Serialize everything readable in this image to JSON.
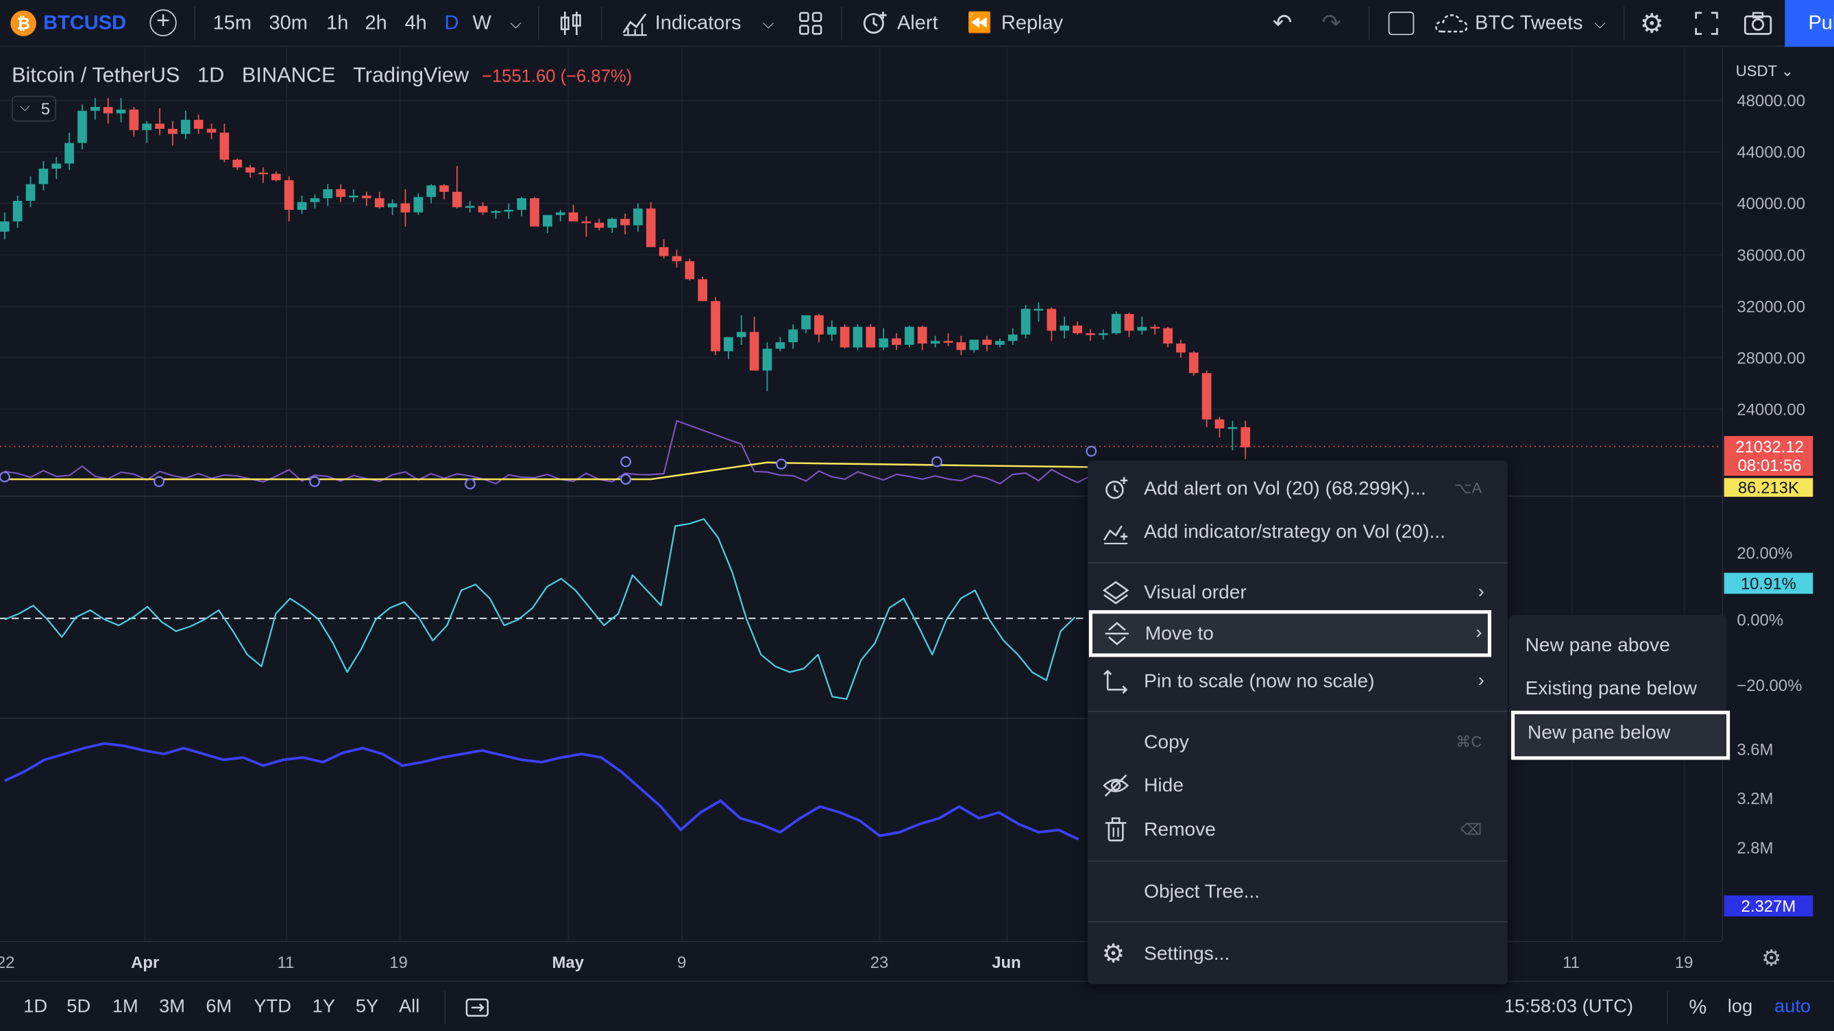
{
  "topbar": {
    "symbol": "BTCUSD",
    "intervals": [
      "15m",
      "30m",
      "1h",
      "2h",
      "4h",
      "D",
      "W"
    ],
    "active_interval": "D",
    "indicators_label": "Indicators",
    "alert_label": "Alert",
    "replay_label": "Replay",
    "layout_name": "BTC Tweets",
    "publish_label": "Pul"
  },
  "legend": {
    "pair": "Bitcoin / TetherUS",
    "interval": "1D",
    "exchange": "BINANCE",
    "source": "TradingView",
    "change": "−1551.60 (−6.87%)",
    "collapsed_count": "5"
  },
  "price_scale": {
    "currency": "USDT",
    "labels": [
      "48000.00",
      "44000.00",
      "40000.00",
      "36000.00",
      "32000.00",
      "28000.00",
      "24000.00"
    ],
    "last_price": "21032.12",
    "countdown": "08:01:56",
    "vol_tag": "86.213K",
    "osc_labels": [
      "20.00%",
      "0.00%",
      "−20.00%"
    ],
    "osc_tag": "10.91%",
    "obv_labels": [
      "3.6M",
      "3.2M",
      "2.8M"
    ],
    "obv_tag": "2.327M"
  },
  "time_axis": [
    "22",
    "Apr",
    "11",
    "19",
    "May",
    "9",
    "23",
    "Jun",
    "11",
    "19"
  ],
  "bottombar": {
    "ranges": [
      "1D",
      "5D",
      "1M",
      "3M",
      "6M",
      "YTD",
      "1Y",
      "5Y",
      "All"
    ],
    "clock": "15:58:03 (UTC)",
    "percent": "%",
    "log": "log",
    "auto": "auto"
  },
  "context_menu": {
    "add_alert": "Add alert on Vol (20) (68.299K)...",
    "add_alert_shortcut": "⌥A",
    "add_indicator": "Add indicator/strategy on Vol (20)...",
    "visual_order": "Visual order",
    "move_to": "Move to",
    "pin_to_scale": "Pin to scale (now no scale)",
    "copy": "Copy",
    "copy_shortcut": "⌘C",
    "hide": "Hide",
    "remove": "Remove",
    "remove_shortcut": "⌫",
    "object_tree": "Object Tree...",
    "settings": "Settings..."
  },
  "submenu": {
    "new_pane_above": "New pane above",
    "existing_pane_below": "Existing pane below",
    "new_pane_below": "New pane below"
  },
  "colors": {
    "up": "#26a69a",
    "down": "#ef5350",
    "accent": "#2962ff",
    "volume_line": "#7e57c2",
    "volume_ma": "#f7e559",
    "oscillator": "#4dd0e1",
    "obv": "#3d41ff"
  },
  "chart_data": {
    "type": "candlestick",
    "title": "Bitcoin / TetherUS",
    "interval": "1D",
    "ylim": [
      20000,
      50000
    ],
    "candles": [
      [
        37800,
        39300,
        37200,
        38600
      ],
      [
        38600,
        40600,
        38100,
        40200
      ],
      [
        40200,
        42100,
        39700,
        41500
      ],
      [
        41500,
        43300,
        41000,
        42700
      ],
      [
        42700,
        43600,
        41900,
        43100
      ],
      [
        43100,
        45500,
        42600,
        44700
      ],
      [
        44700,
        47700,
        44200,
        47200
      ],
      [
        47200,
        48200,
        46500,
        47500
      ],
      [
        47500,
        48200,
        46200,
        47000
      ],
      [
        47000,
        48200,
        46300,
        47300
      ],
      [
        47300,
        47500,
        45200,
        45700
      ],
      [
        45700,
        46400,
        44700,
        46200
      ],
      [
        46200,
        47400,
        45300,
        45800
      ],
      [
        45800,
        46400,
        44500,
        45400
      ],
      [
        45400,
        47200,
        45000,
        46500
      ],
      [
        46500,
        46900,
        45400,
        45800
      ],
      [
        45800,
        46200,
        45000,
        45500
      ],
      [
        45500,
        46200,
        43200,
        43400
      ],
      [
        43400,
        43500,
        42600,
        42800
      ],
      [
        42800,
        43000,
        42000,
        42400
      ],
      [
        42400,
        42800,
        41600,
        42300
      ],
      [
        42300,
        42500,
        41700,
        41800
      ],
      [
        41800,
        42100,
        38600,
        39500
      ],
      [
        39500,
        40600,
        39200,
        40100
      ],
      [
        40100,
        40700,
        39600,
        40400
      ],
      [
        40400,
        41500,
        39800,
        41100
      ],
      [
        41100,
        41500,
        40100,
        40500
      ],
      [
        40500,
        41100,
        40100,
        40600
      ],
      [
        40600,
        40900,
        39800,
        40400
      ],
      [
        40400,
        40900,
        39600,
        39700
      ],
      [
        39700,
        40300,
        39100,
        40000
      ],
      [
        40000,
        41100,
        38200,
        39300
      ],
      [
        39300,
        40800,
        39100,
        40500
      ],
      [
        40500,
        41500,
        40000,
        41400
      ],
      [
        41400,
        41500,
        40300,
        40900
      ],
      [
        40900,
        42900,
        39600,
        39700
      ],
      [
        39700,
        40200,
        39300,
        39800
      ],
      [
        39800,
        40100,
        39100,
        39300
      ],
      [
        39300,
        39500,
        38800,
        39400
      ],
      [
        39400,
        40000,
        38800,
        39500
      ],
      [
        39500,
        40500,
        39000,
        40400
      ],
      [
        40400,
        40500,
        38200,
        38200
      ],
      [
        38200,
        39000,
        37700,
        39100
      ],
      [
        39100,
        39500,
        38600,
        39300
      ],
      [
        39300,
        39900,
        38600,
        38600
      ],
      [
        38600,
        39000,
        37400,
        38500
      ],
      [
        38500,
        38800,
        37900,
        38100
      ],
      [
        38100,
        38900,
        37700,
        38800
      ],
      [
        38800,
        39200,
        37600,
        38300
      ],
      [
        38300,
        40000,
        37800,
        39600
      ],
      [
        39600,
        40100,
        37000,
        36600
      ],
      [
        36600,
        37200,
        35700,
        35900
      ],
      [
        35900,
        36400,
        35000,
        35500
      ],
      [
        35500,
        35700,
        34000,
        34100
      ],
      [
        34100,
        34300,
        32500,
        32400
      ],
      [
        32400,
        32700,
        28200,
        28500
      ],
      [
        28500,
        29600,
        27900,
        29600
      ],
      [
        29600,
        31300,
        29000,
        30000
      ],
      [
        30000,
        31200,
        28200,
        27000
      ],
      [
        27000,
        29200,
        25400,
        28700
      ],
      [
        28700,
        29600,
        28500,
        29200
      ],
      [
        29200,
        30600,
        28700,
        30200
      ],
      [
        30200,
        31300,
        29900,
        31300
      ],
      [
        31300,
        31400,
        29200,
        29800
      ],
      [
        29800,
        30900,
        29300,
        30400
      ],
      [
        30400,
        30600,
        28700,
        28800
      ],
      [
        28800,
        30600,
        28600,
        30400
      ],
      [
        30400,
        30600,
        28800,
        28800
      ],
      [
        28800,
        30300,
        28600,
        29500
      ],
      [
        29500,
        29900,
        28600,
        29000
      ],
      [
        29000,
        30500,
        28800,
        30400
      ],
      [
        30400,
        30500,
        28600,
        29100
      ],
      [
        29100,
        29700,
        28800,
        29300
      ],
      [
        29300,
        29900,
        28900,
        29200
      ],
      [
        29200,
        29700,
        28200,
        28600
      ],
      [
        28600,
        29400,
        28400,
        29400
      ],
      [
        29400,
        29700,
        28500,
        29000
      ],
      [
        29000,
        29500,
        28800,
        29300
      ],
      [
        29300,
        30300,
        29000,
        29800
      ],
      [
        29800,
        32100,
        29500,
        31800
      ],
      [
        31800,
        32300,
        30800,
        31800
      ],
      [
        31800,
        31900,
        29300,
        30100
      ],
      [
        30100,
        31200,
        29500,
        30500
      ],
      [
        30500,
        30800,
        29800,
        29900
      ],
      [
        29900,
        30200,
        29300,
        29800
      ],
      [
        29800,
        30200,
        29400,
        29900
      ],
      [
        29900,
        31600,
        29800,
        31400
      ],
      [
        31400,
        31500,
        29600,
        30100
      ],
      [
        30100,
        31200,
        29800,
        30400
      ],
      [
        30400,
        30600,
        29800,
        30300
      ],
      [
        30300,
        30400,
        28800,
        29100
      ],
      [
        29100,
        29400,
        28000,
        28400
      ],
      [
        28400,
        28500,
        26600,
        26800
      ],
      [
        26800,
        27000,
        22600,
        23200
      ],
      [
        23200,
        23400,
        21800,
        22500
      ],
      [
        22500,
        23100,
        20800,
        22600
      ],
      [
        22600,
        23100,
        20100,
        21032
      ]
    ]
  }
}
